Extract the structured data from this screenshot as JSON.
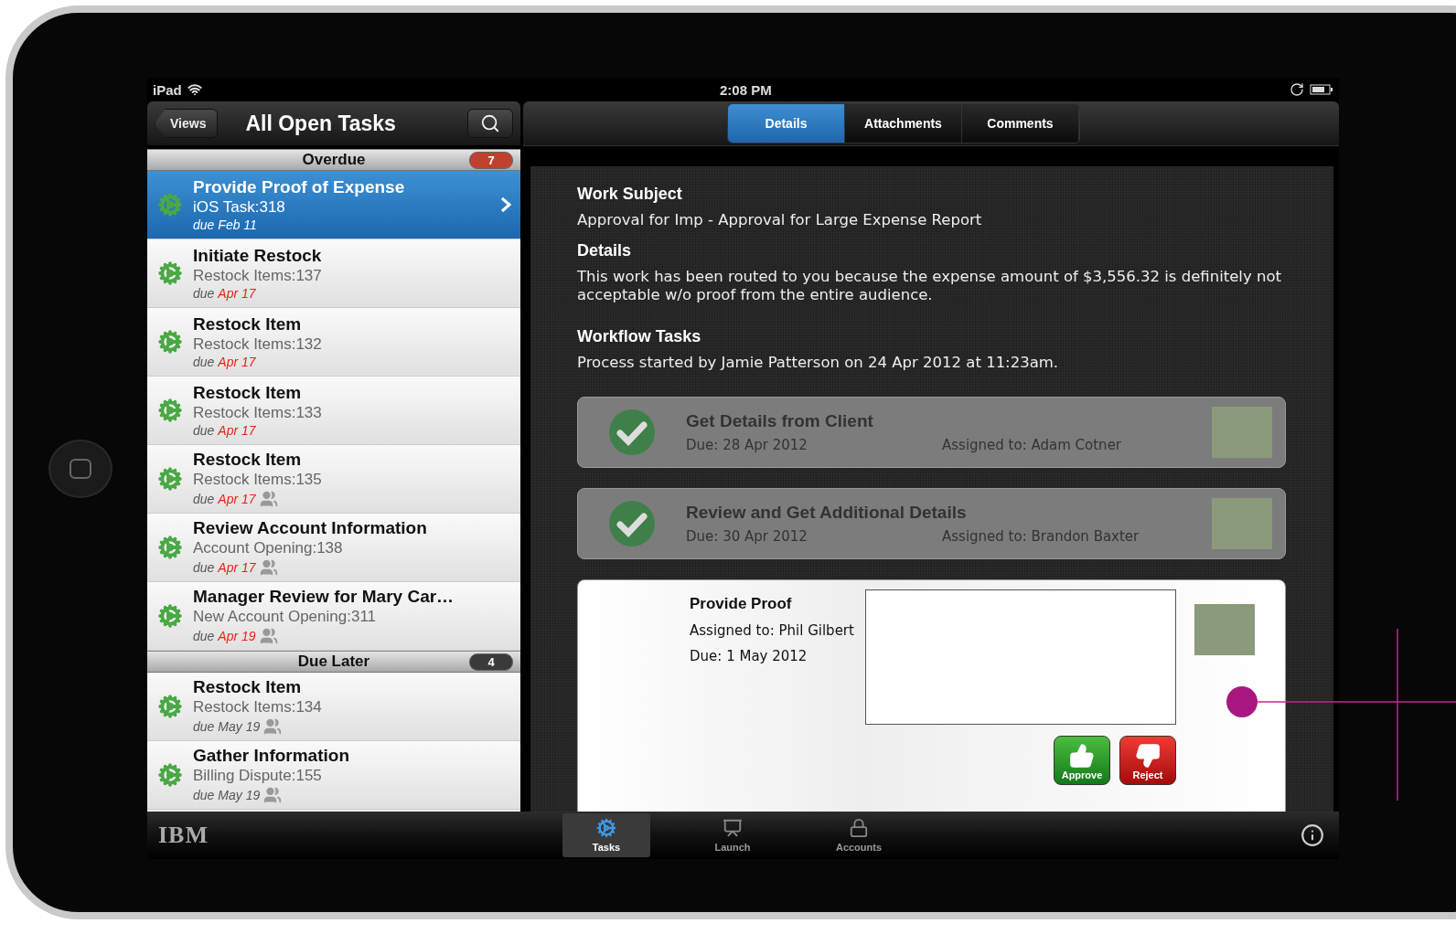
{
  "status_bar": {
    "device": "iPad",
    "time": "2:08 PM"
  },
  "nav_bar": {
    "back_button": "Views",
    "title": "All Open Tasks"
  },
  "tabs": [
    {
      "label": "Details",
      "selected": true
    },
    {
      "label": "Attachments",
      "selected": false
    },
    {
      "label": "Comments",
      "selected": false
    }
  ],
  "task_list": {
    "sections": [
      {
        "title": "Overdue",
        "count": "7",
        "color": "#c0402e",
        "items": [
          {
            "title": "Provide Proof of Expense",
            "subtitle": "iOS Task:318",
            "due_prefix": "due",
            "due_date": "Feb 11",
            "overdue": false,
            "shared": false,
            "selected": true
          },
          {
            "title": "Initiate Restock",
            "subtitle": "Restock Items:137",
            "due_prefix": "due",
            "due_date": "Apr 17",
            "overdue": true,
            "shared": false,
            "selected": false
          },
          {
            "title": "Restock Item",
            "subtitle": "Restock Items:132",
            "due_prefix": "due",
            "due_date": "Apr 17",
            "overdue": true,
            "shared": false,
            "selected": false
          },
          {
            "title": "Restock Item",
            "subtitle": "Restock Items:133",
            "due_prefix": "due",
            "due_date": "Apr 17",
            "overdue": true,
            "shared": false,
            "selected": false
          },
          {
            "title": "Restock Item",
            "subtitle": "Restock Items:135",
            "due_prefix": "due",
            "due_date": "Apr 17",
            "overdue": true,
            "shared": true,
            "selected": false
          },
          {
            "title": "Review Account Information",
            "subtitle": "Account Opening:138",
            "due_prefix": "due",
            "due_date": "Apr 17",
            "overdue": true,
            "shared": true,
            "selected": false
          },
          {
            "title": "Manager Review for Mary Car…",
            "subtitle": "New Account Opening:311",
            "due_prefix": "due",
            "due_date": "Apr 19",
            "overdue": true,
            "shared": true,
            "selected": false
          }
        ]
      },
      {
        "title": "Due Later",
        "count": "4",
        "color": "#3a3a3a",
        "items": [
          {
            "title": "Restock Item",
            "subtitle": "Restock Items:134",
            "due_prefix": "due",
            "due_date": "May 19",
            "overdue": false,
            "shared": true,
            "selected": false
          },
          {
            "title": "Gather Information",
            "subtitle": "Billing Dispute:155",
            "due_prefix": "due",
            "due_date": "May 19",
            "overdue": false,
            "shared": true,
            "selected": false
          }
        ]
      }
    ]
  },
  "detail": {
    "work_subject_label": "Work Subject",
    "work_subject": "Approval for Imp - Approval for Large Expense Report",
    "details_label": "Details",
    "details_text": "This work has been routed to you because the expense amount of $3,556.32 is definitely not acceptable w/o proof from the entire audience.",
    "workflow_label": "Workflow Tasks",
    "process_text": "Process started by Jamie Patterson on 24 Apr 2012 at 11:23am.",
    "workflow_tasks": [
      {
        "kind": "completed",
        "title": "Get Details from Client",
        "due_label": "Due:",
        "due": "28 Apr 2012",
        "assigned_label": "Assigned to:",
        "assignee": "Adam Cotner"
      },
      {
        "kind": "completed",
        "title": "Review and Get Additional Details",
        "due_label": "Due:",
        "due": "30 Apr 2012",
        "assigned_label": "Assigned to:",
        "assignee": "Brandon Baxter"
      },
      {
        "kind": "active",
        "title": "Provide Proof",
        "due_label": "Due:",
        "due": "1 May 2012",
        "assigned_label": "Assigned to:",
        "assignee": "Phil Gilbert",
        "approve": "Approve",
        "reject": "Reject"
      }
    ]
  },
  "tab_bar": {
    "logo": "IBM",
    "items": [
      {
        "label": "Tasks",
        "kind": "tasks",
        "selected": true
      },
      {
        "label": "Launch",
        "kind": "launch",
        "selected": false
      },
      {
        "label": "Accounts",
        "kind": "accounts",
        "selected": false
      }
    ]
  }
}
